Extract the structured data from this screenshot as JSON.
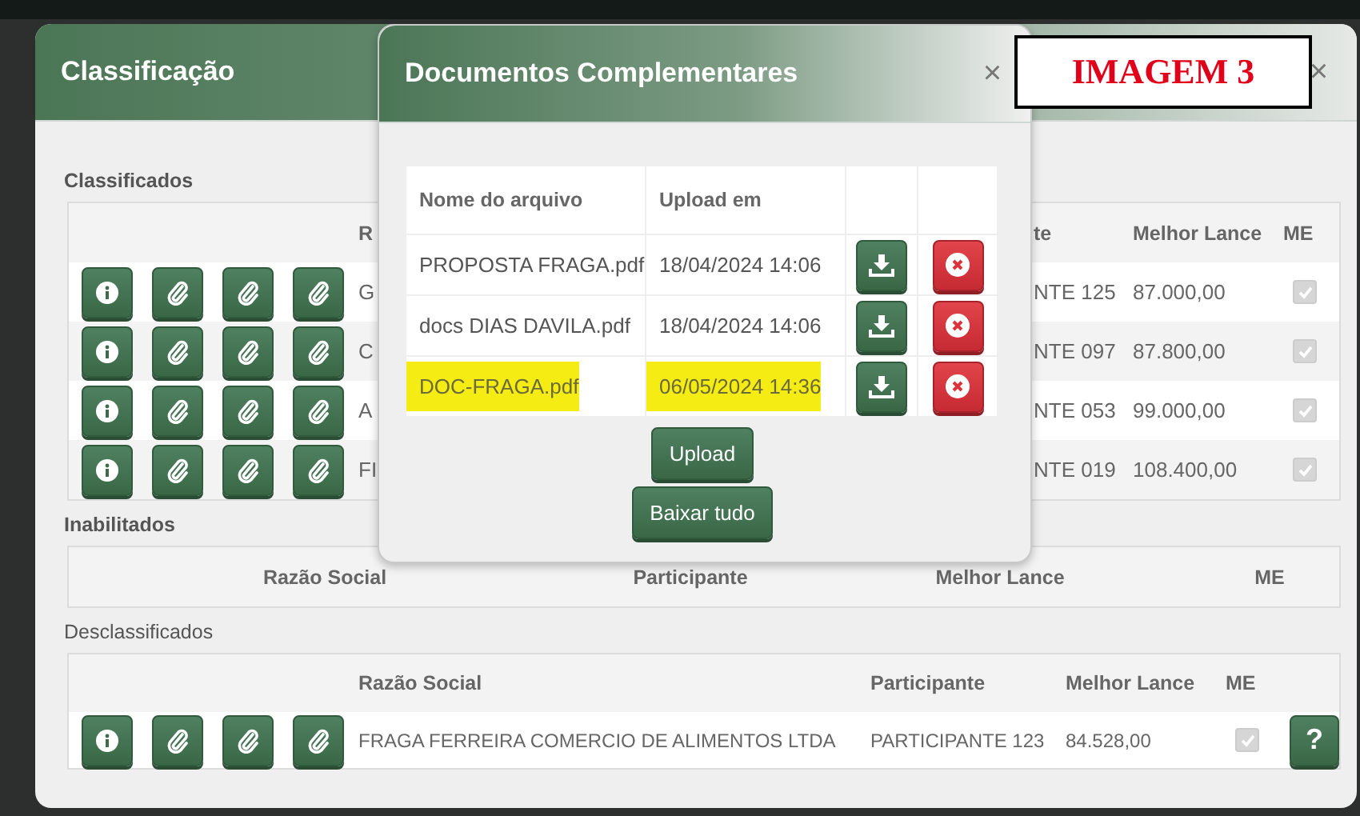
{
  "classificacao_dialog": {
    "title": "Classificação",
    "close": "×",
    "classificados": {
      "label": "Classificados",
      "columns": [
        "R",
        "te",
        "Melhor Lance",
        "ME"
      ],
      "rows": [
        {
          "razao_social": "G",
          "participante": "NTE 125",
          "melhor_lance": "87.000,00",
          "me": true
        },
        {
          "razao_social": "C",
          "participante": "NTE 097",
          "melhor_lance": "87.800,00",
          "me": true
        },
        {
          "razao_social": "A",
          "participante": "NTE 053",
          "melhor_lance": "99.000,00",
          "me": true
        },
        {
          "razao_social": "FI",
          "participante": "NTE 019",
          "melhor_lance": "108.400,00",
          "me": true
        }
      ]
    },
    "inabilitados": {
      "label": "Inabilitados",
      "columns": [
        "Razão Social",
        "Participante",
        "Melhor Lance",
        "ME"
      ]
    },
    "desclassificados": {
      "label": "Desclassificados",
      "columns": [
        "Razão Social",
        "Participante",
        "Melhor Lance",
        "ME"
      ],
      "rows": [
        {
          "razao_social": "FRAGA FERREIRA COMERCIO DE ALIMENTOS LTDA",
          "participante": "PARTICIPANTE 123",
          "melhor_lance": "84.528,00",
          "me": true,
          "help": "?"
        }
      ]
    }
  },
  "documentos_dialog": {
    "title": "Documentos Complementares",
    "close": "×",
    "columns": [
      "Nome do arquivo",
      "Upload em"
    ],
    "files": [
      {
        "name": "PROPOSTA FRAGA.pdf",
        "uploaded": "18/04/2024 14:06",
        "highlighted": false
      },
      {
        "name": "docs DIAS DAVILA.pdf",
        "uploaded": "18/04/2024 14:06",
        "highlighted": false
      },
      {
        "name": "DOC-FRAGA.pdf",
        "uploaded": "06/05/2024 14:36",
        "highlighted": true
      }
    ],
    "buttons": [
      "Upload",
      "Baixar tudo"
    ]
  },
  "annotation": {
    "text": "IMAGEM 3"
  }
}
